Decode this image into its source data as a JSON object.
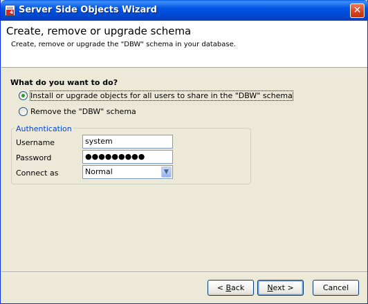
{
  "window": {
    "title": "Server Side Objects Wizard",
    "close_glyph": "✕"
  },
  "header": {
    "title": "Create, remove or upgrade schema",
    "subtitle": "Create, remove or upgrade the \"DBW\" schema in your database."
  },
  "question": "What do you want to do?",
  "options": [
    {
      "label": "Install or upgrade objects for all users to share in the \"DBW\" schema",
      "checked": true
    },
    {
      "label": "Remove the \"DBW\" schema",
      "checked": false
    }
  ],
  "auth": {
    "legend": "Authentication",
    "username_label": "Username",
    "username_value": "system",
    "password_label": "Password",
    "password_value": "●●●●●●●●●",
    "connect_label": "Connect as",
    "connect_value": "Normal"
  },
  "buttons": {
    "back_prefix": "< ",
    "back_mnemonic": "B",
    "back_rest": "ack",
    "next_mnemonic": "N",
    "next_rest": "ext >",
    "cancel": "Cancel"
  },
  "colors": {
    "accent": "#0046D5",
    "radio_dot": "#21A121",
    "title_bar": "#0055E5"
  },
  "icons": {
    "app": "app-icon",
    "close": "close-icon",
    "dropdown": "chevron-down-icon"
  }
}
